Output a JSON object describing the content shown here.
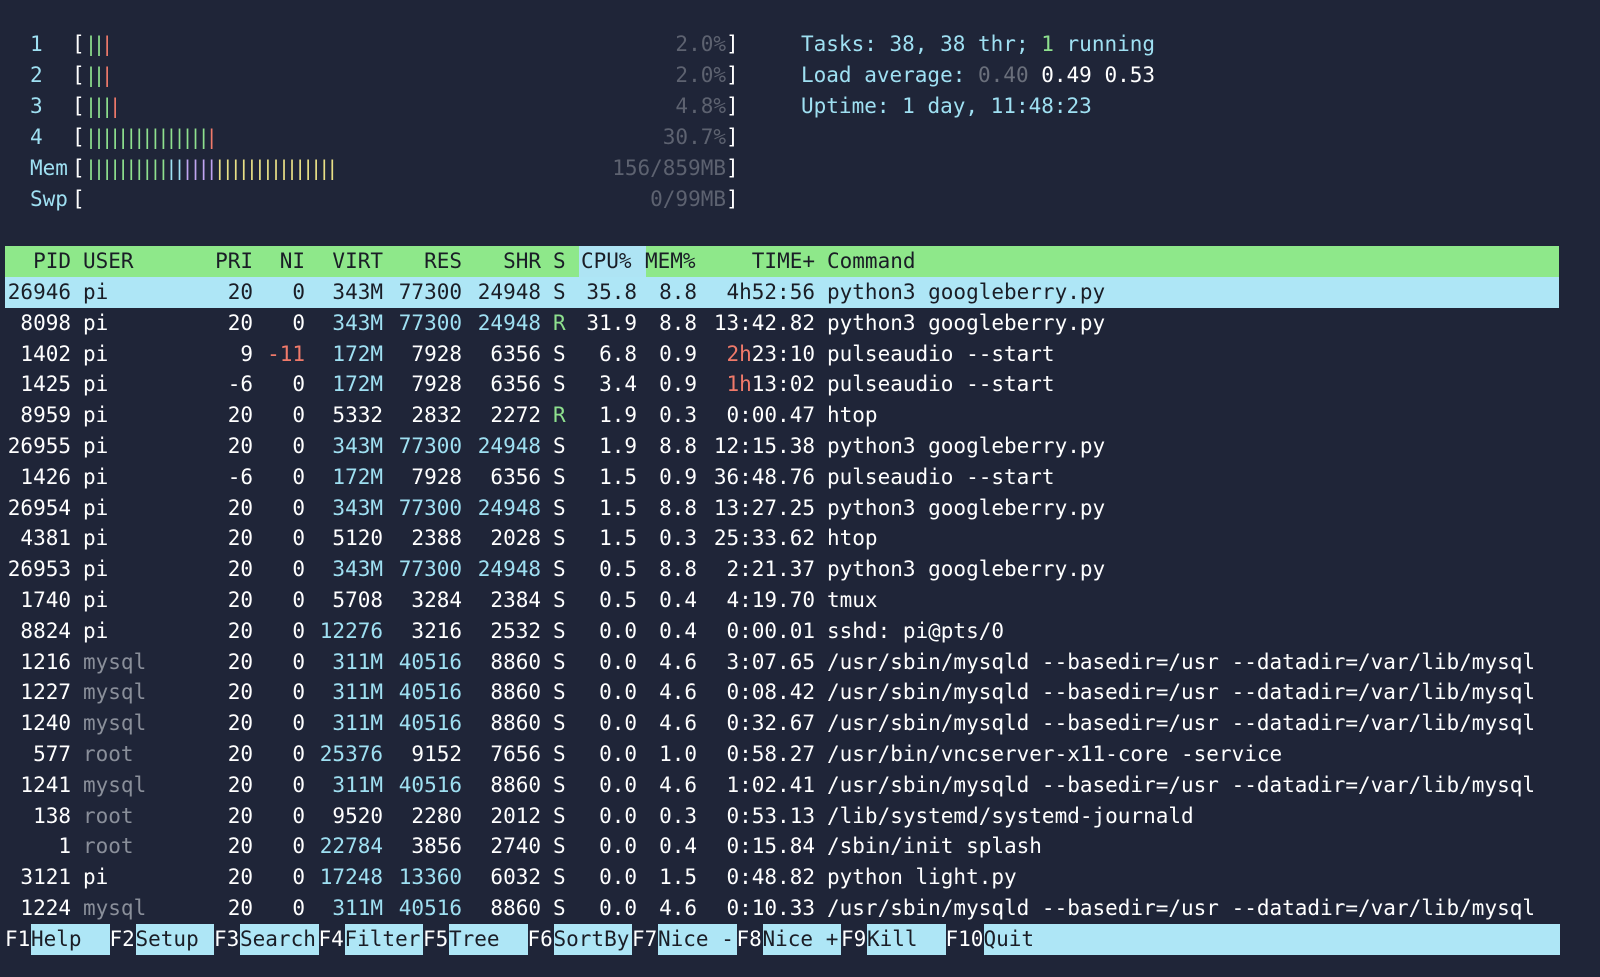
{
  "meters": [
    {
      "label": "1",
      "close": "]",
      "value": "2.0%",
      "bars": [
        {
          "t": "||",
          "c": "green"
        }
      ],
      "barsB": [
        {
          "t": "|",
          "c": "red"
        }
      ]
    },
    {
      "label": "2",
      "close": "]",
      "value": "2.0%",
      "bars": [
        {
          "t": "||",
          "c": "green"
        }
      ],
      "barsB": [
        {
          "t": "|",
          "c": "red"
        }
      ]
    },
    {
      "label": "3",
      "close": "]",
      "value": "4.8%",
      "bars": [
        {
          "t": "|||",
          "c": "green"
        }
      ],
      "barsB": [
        {
          "t": "|",
          "c": "red"
        }
      ]
    },
    {
      "label": "4",
      "close": "]",
      "value": "30.7%",
      "bars": [
        {
          "t": "|||||||||||||||",
          "c": "green"
        }
      ],
      "barsB": [
        {
          "t": "|",
          "c": "red"
        }
      ]
    },
    {
      "label": "Mem",
      "close": "]",
      "value": "156/859MB",
      "bars": [
        {
          "t": "||||||||||",
          "c": "green"
        },
        {
          "t": "||",
          "c": "cyan"
        },
        {
          "t": "||||",
          "c": "purple"
        }
      ],
      "barsB": [
        {
          "t": "|||||||||||||||",
          "c": "yellow"
        }
      ]
    },
    {
      "label": "Swp",
      "close": "]",
      "value": "0/99MB",
      "bars": [],
      "barsB": []
    }
  ],
  "open_bracket": "[",
  "stats": {
    "tasks_label": "Tasks: ",
    "tasks_value": "38, 38 thr; ",
    "running_count": "1",
    "running_label": " running",
    "load_label": "Load average: ",
    "load_1": "0.40",
    "load_5": "0.49",
    "load_15": "0.53",
    "uptime_label": "Uptime: ",
    "uptime_value": "1 day, 11:48:23"
  },
  "columns": {
    "pid": "PID",
    "user": "USER",
    "pri": "PRI",
    "ni": "NI",
    "virt": "VIRT",
    "res": "RES",
    "shr": "SHR",
    "s": "S",
    "cpu": "CPU%",
    "mem": "MEM%",
    "time": "TIME+",
    "command": "Command"
  },
  "processes": [
    {
      "pid": "26946",
      "user": "pi",
      "pri": "20",
      "ni": "0",
      "virt": "343M",
      "res": "77300",
      "shr": "24948",
      "s": "S",
      "cpu": "35.8",
      "mem": "8.8",
      "time_a": "",
      "time_b": "4h52:56",
      "command": "python3 googleberry.py",
      "selected": true
    },
    {
      "pid": "8098",
      "user": "pi",
      "pri": "20",
      "ni": "0",
      "virt": "343M",
      "res": "77300",
      "shr": "24948",
      "s": "R",
      "cpu": "31.9",
      "mem": "8.8",
      "time_a": "",
      "time_b": "13:42.82",
      "command": "python3 googleberry.py"
    },
    {
      "pid": "1402",
      "user": "pi",
      "pri": "9",
      "ni": "-11",
      "virt": "172M",
      "res": "7928",
      "shr": "6356",
      "s": "S",
      "cpu": "6.8",
      "mem": "0.9",
      "time_a": "2h",
      "time_b": "23:10",
      "command": "pulseaudio --start"
    },
    {
      "pid": "1425",
      "user": "pi",
      "pri": "-6",
      "ni": "0",
      "virt": "172M",
      "res": "7928",
      "shr": "6356",
      "s": "S",
      "cpu": "3.4",
      "mem": "0.9",
      "time_a": "1h",
      "time_b": "13:02",
      "command": "pulseaudio --start"
    },
    {
      "pid": "8959",
      "user": "pi",
      "pri": "20",
      "ni": "0",
      "virt": "5332",
      "res": "2832",
      "shr": "2272",
      "s": "R",
      "cpu": "1.9",
      "mem": "0.3",
      "time_a": "",
      "time_b": "0:00.47",
      "command": "htop"
    },
    {
      "pid": "26955",
      "user": "pi",
      "pri": "20",
      "ni": "0",
      "virt": "343M",
      "res": "77300",
      "shr": "24948",
      "s": "S",
      "cpu": "1.9",
      "mem": "8.8",
      "time_a": "",
      "time_b": "12:15.38",
      "command": "python3 googleberry.py"
    },
    {
      "pid": "1426",
      "user": "pi",
      "pri": "-6",
      "ni": "0",
      "virt": "172M",
      "res": "7928",
      "shr": "6356",
      "s": "S",
      "cpu": "1.5",
      "mem": "0.9",
      "time_a": "",
      "time_b": "36:48.76",
      "command": "pulseaudio --start"
    },
    {
      "pid": "26954",
      "user": "pi",
      "pri": "20",
      "ni": "0",
      "virt": "343M",
      "res": "77300",
      "shr": "24948",
      "s": "S",
      "cpu": "1.5",
      "mem": "8.8",
      "time_a": "",
      "time_b": "13:27.25",
      "command": "python3 googleberry.py"
    },
    {
      "pid": "4381",
      "user": "pi",
      "pri": "20",
      "ni": "0",
      "virt": "5120",
      "res": "2388",
      "shr": "2028",
      "s": "S",
      "cpu": "1.5",
      "mem": "0.3",
      "time_a": "",
      "time_b": "25:33.62",
      "command": "htop"
    },
    {
      "pid": "26953",
      "user": "pi",
      "pri": "20",
      "ni": "0",
      "virt": "343M",
      "res": "77300",
      "shr": "24948",
      "s": "S",
      "cpu": "0.5",
      "mem": "8.8",
      "time_a": "",
      "time_b": "2:21.37",
      "command": "python3 googleberry.py"
    },
    {
      "pid": "1740",
      "user": "pi",
      "pri": "20",
      "ni": "0",
      "virt": "5708",
      "res": "3284",
      "shr": "2384",
      "s": "S",
      "cpu": "0.5",
      "mem": "0.4",
      "time_a": "",
      "time_b": "4:19.70",
      "command": "tmux"
    },
    {
      "pid": "8824",
      "user": "pi",
      "pri": "20",
      "ni": "0",
      "virt": "12276",
      "res": "3216",
      "shr": "2532",
      "s": "S",
      "cpu": "0.0",
      "mem": "0.4",
      "time_a": "",
      "time_b": "0:00.01",
      "command": "sshd: pi@pts/0"
    },
    {
      "pid": "1216",
      "user": "mysql",
      "pri": "20",
      "ni": "0",
      "virt": "311M",
      "res": "40516",
      "shr": "8860",
      "s": "S",
      "cpu": "0.0",
      "mem": "4.6",
      "time_a": "",
      "time_b": "3:07.65",
      "command": "/usr/sbin/mysqld --basedir=/usr --datadir=/var/lib/mysql"
    },
    {
      "pid": "1227",
      "user": "mysql",
      "pri": "20",
      "ni": "0",
      "virt": "311M",
      "res": "40516",
      "shr": "8860",
      "s": "S",
      "cpu": "0.0",
      "mem": "4.6",
      "time_a": "",
      "time_b": "0:08.42",
      "command": "/usr/sbin/mysqld --basedir=/usr --datadir=/var/lib/mysql"
    },
    {
      "pid": "1240",
      "user": "mysql",
      "pri": "20",
      "ni": "0",
      "virt": "311M",
      "res": "40516",
      "shr": "8860",
      "s": "S",
      "cpu": "0.0",
      "mem": "4.6",
      "time_a": "",
      "time_b": "0:32.67",
      "command": "/usr/sbin/mysqld --basedir=/usr --datadir=/var/lib/mysql"
    },
    {
      "pid": "577",
      "user": "root",
      "pri": "20",
      "ni": "0",
      "virt": "25376",
      "res": "9152",
      "shr": "7656",
      "s": "S",
      "cpu": "0.0",
      "mem": "1.0",
      "time_a": "",
      "time_b": "0:58.27",
      "command": "/usr/bin/vncserver-x11-core -service"
    },
    {
      "pid": "1241",
      "user": "mysql",
      "pri": "20",
      "ni": "0",
      "virt": "311M",
      "res": "40516",
      "shr": "8860",
      "s": "S",
      "cpu": "0.0",
      "mem": "4.6",
      "time_a": "",
      "time_b": "1:02.41",
      "command": "/usr/sbin/mysqld --basedir=/usr --datadir=/var/lib/mysql"
    },
    {
      "pid": "138",
      "user": "root",
      "pri": "20",
      "ni": "0",
      "virt": "9520",
      "res": "2280",
      "shr": "2012",
      "s": "S",
      "cpu": "0.0",
      "mem": "0.3",
      "time_a": "",
      "time_b": "0:53.13",
      "command": "/lib/systemd/systemd-journald"
    },
    {
      "pid": "1",
      "user": "root",
      "pri": "20",
      "ni": "0",
      "virt": "22784",
      "res": "3856",
      "shr": "2740",
      "s": "S",
      "cpu": "0.0",
      "mem": "0.4",
      "time_a": "",
      "time_b": "0:15.84",
      "command": "/sbin/init splash"
    },
    {
      "pid": "3121",
      "user": "pi",
      "pri": "20",
      "ni": "0",
      "virt": "17248",
      "res": "13360",
      "shr": "6032",
      "s": "S",
      "cpu": "0.0",
      "mem": "1.5",
      "time_a": "",
      "time_b": "0:48.82",
      "command": "python light.py"
    },
    {
      "pid": "1224",
      "user": "mysql",
      "pri": "20",
      "ni": "0",
      "virt": "311M",
      "res": "40516",
      "shr": "8860",
      "s": "S",
      "cpu": "0.0",
      "mem": "4.6",
      "time_a": "",
      "time_b": "0:10.33",
      "command": "/usr/sbin/mysqld --basedir=/usr --datadir=/var/lib/mysql"
    }
  ],
  "footer": [
    {
      "key": "F1",
      "label": "Help  "
    },
    {
      "key": "F2",
      "label": "Setup "
    },
    {
      "key": "F3",
      "label": "Search"
    },
    {
      "key": "F4",
      "label": "Filter"
    },
    {
      "key": "F5",
      "label": "Tree  "
    },
    {
      "key": "F6",
      "label": "SortBy"
    },
    {
      "key": "F7",
      "label": "Nice -"
    },
    {
      "key": "F8",
      "label": "Nice +"
    },
    {
      "key": "F9",
      "label": "Kill  "
    },
    {
      "key": "F10",
      "label": "Quit"
    }
  ],
  "colors": {
    "background": "#1f2538",
    "header_bg": "#8ee88a",
    "selected_bg": "#aee6f6",
    "cyan": "#9fe0f2",
    "green": "#8ee08e",
    "red": "#f07a6a"
  }
}
